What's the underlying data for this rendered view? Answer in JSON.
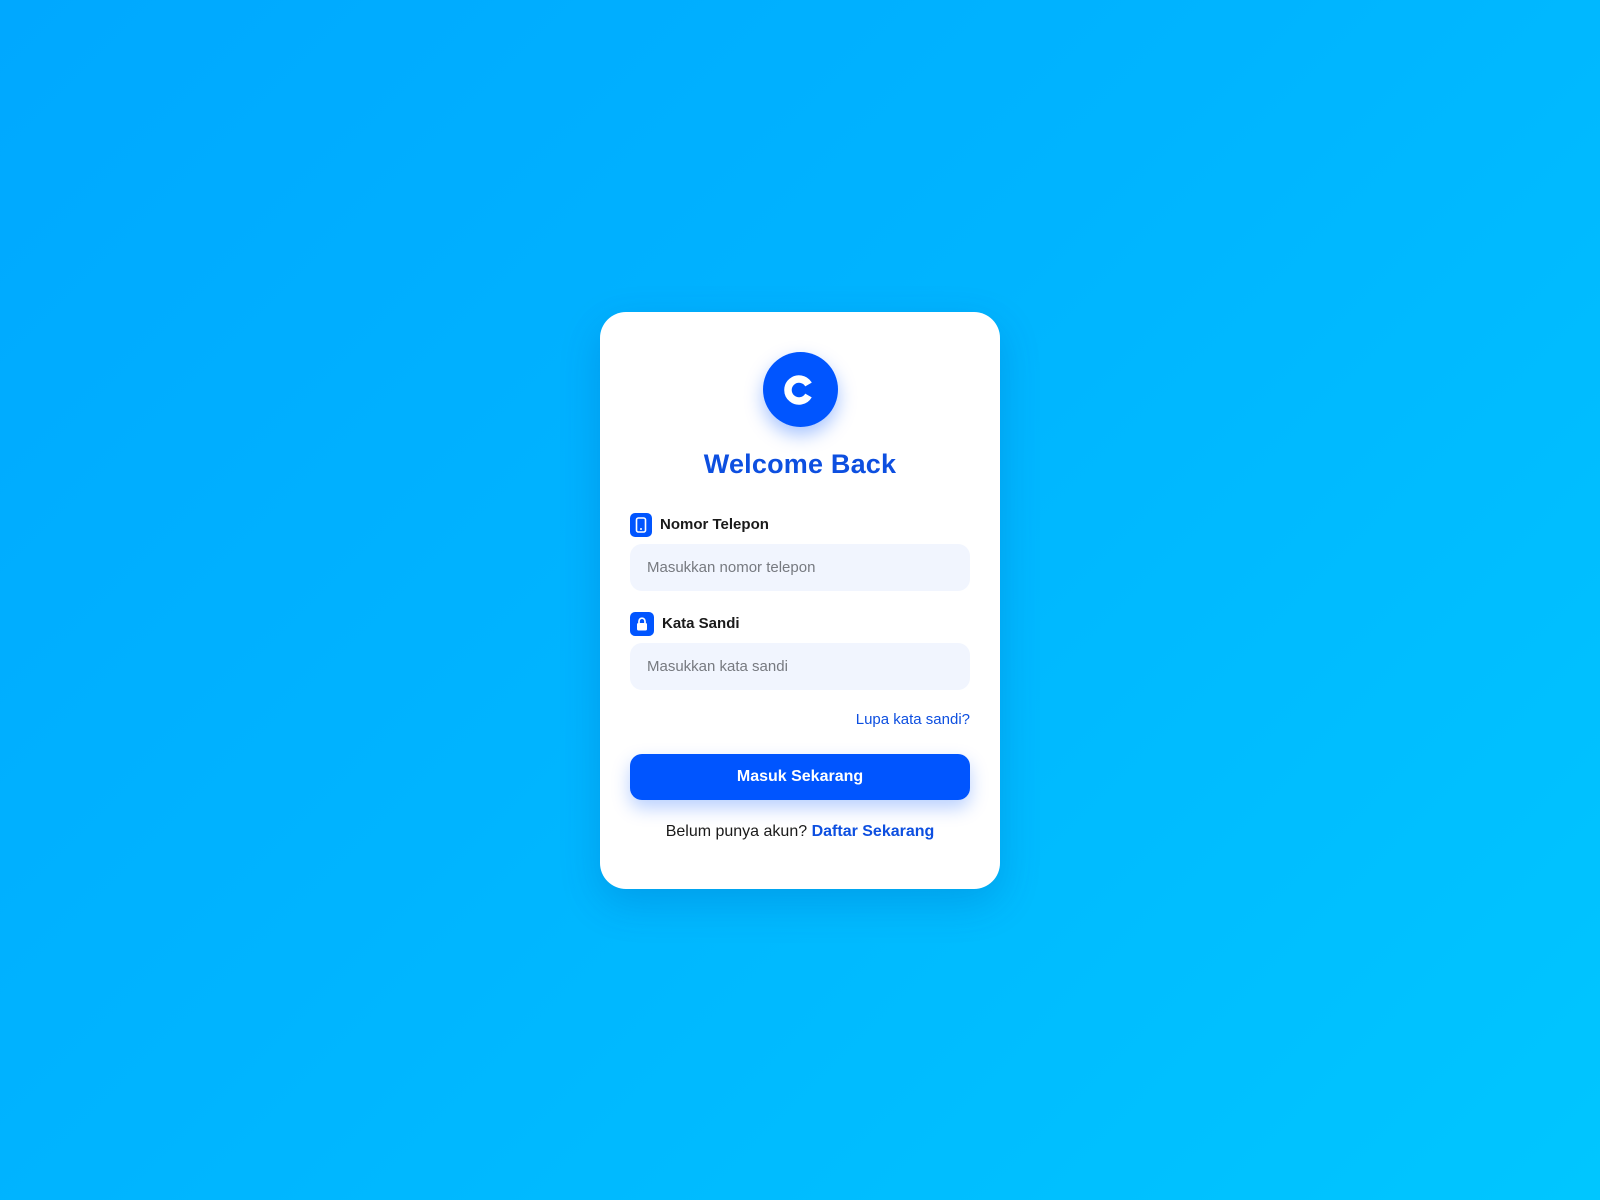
{
  "login": {
    "logo": {
      "icon": "c-logo-icon",
      "letter": "C"
    },
    "title": "Welcome Back",
    "phone": {
      "icon": "phone-icon",
      "label": "Nomor Telepon",
      "placeholder": "Masukkan nomor telepon",
      "value": ""
    },
    "password": {
      "icon": "lock-icon",
      "label": "Kata Sandi",
      "placeholder": "Masukkan kata sandi",
      "value": ""
    },
    "forgot_link": "Lupa kata sandi?",
    "submit_label": "Masuk Sekarang",
    "signup_prompt": "Belum punya akun?",
    "signup_link": "Daftar Sekarang"
  },
  "colors": {
    "background_start": "#00a8ff",
    "background_end": "#00c6ff",
    "accent": "#0055ff",
    "title": "#0d4fe0",
    "input_bg": "#f1f5fe"
  }
}
